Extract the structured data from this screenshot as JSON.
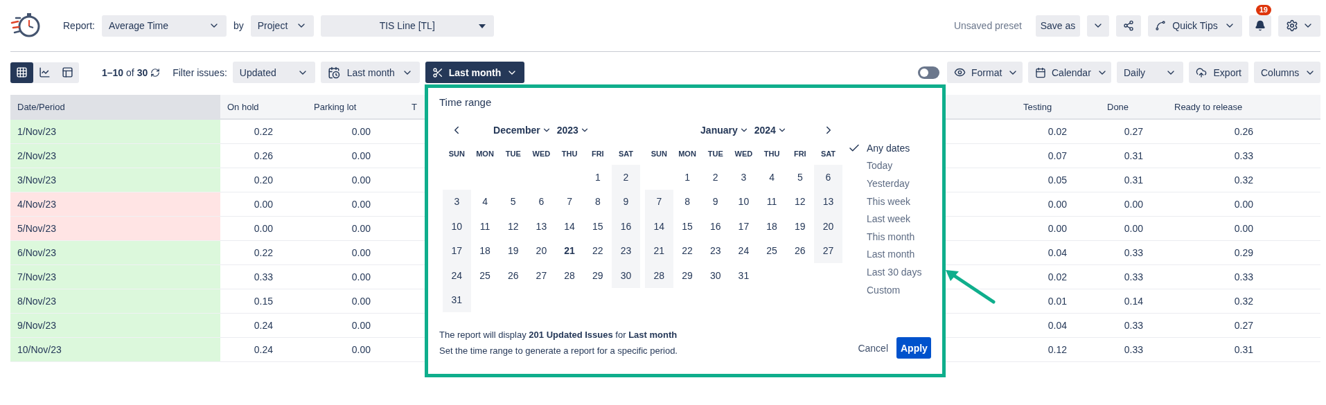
{
  "header": {
    "report_label": "Report:",
    "report_type": "Average Time",
    "by_label": "by",
    "group_by": "Project",
    "project": "TIS Line [TL]",
    "preset_status": "Unsaved preset",
    "save_button": "Save as",
    "quick_tips": "Quick Tips",
    "notifications_count": "19"
  },
  "toolbar": {
    "views": [
      {
        "kind": "grid",
        "selected": true
      },
      {
        "kind": "chart",
        "selected": false
      },
      {
        "kind": "panels",
        "selected": false
      }
    ],
    "paging": "**1–10** of **30**",
    "filter_label": "Filter issues:",
    "filter_field": "Updated",
    "date_filter": "Last month",
    "time_range_button": "Last month",
    "toggle_on": false,
    "format": "Format",
    "calendar": "Calendar",
    "interval": "Daily",
    "export": "Export",
    "columns": "Columns"
  },
  "table": {
    "columns": [
      "Date/Period",
      "On hold",
      "Parking lot",
      "T",
      "Testing",
      "Done",
      "Ready to release"
    ],
    "rows": [
      {
        "date": "1/Nov/23",
        "weekend": false,
        "on_hold": "0.22",
        "parking_lot": "0.00",
        "testing": "0.02",
        "done": "0.27",
        "ready_to_release": "0.26"
      },
      {
        "date": "2/Nov/23",
        "weekend": false,
        "on_hold": "0.26",
        "parking_lot": "0.00",
        "testing": "0.07",
        "done": "0.31",
        "ready_to_release": "0.33"
      },
      {
        "date": "3/Nov/23",
        "weekend": false,
        "on_hold": "0.20",
        "parking_lot": "0.00",
        "testing": "0.05",
        "done": "0.31",
        "ready_to_release": "0.32"
      },
      {
        "date": "4/Nov/23",
        "weekend": true,
        "on_hold": "0.00",
        "parking_lot": "0.00",
        "testing": "0.00",
        "done": "0.00",
        "ready_to_release": "0.00"
      },
      {
        "date": "5/Nov/23",
        "weekend": true,
        "on_hold": "0.00",
        "parking_lot": "0.00",
        "testing": "0.00",
        "done": "0.00",
        "ready_to_release": "0.00"
      },
      {
        "date": "6/Nov/23",
        "weekend": false,
        "on_hold": "0.22",
        "parking_lot": "0.00",
        "testing": "0.04",
        "done": "0.33",
        "ready_to_release": "0.29"
      },
      {
        "date": "7/Nov/23",
        "weekend": false,
        "on_hold": "0.33",
        "parking_lot": "0.00",
        "testing": "0.02",
        "done": "0.33",
        "ready_to_release": "0.33"
      },
      {
        "date": "8/Nov/23",
        "weekend": false,
        "on_hold": "0.15",
        "parking_lot": "0.00",
        "testing": "0.01",
        "done": "0.14",
        "ready_to_release": "0.32"
      },
      {
        "date": "9/Nov/23",
        "weekend": false,
        "on_hold": "0.24",
        "parking_lot": "0.00",
        "testing": "0.04",
        "done": "0.33",
        "ready_to_release": "0.27"
      },
      {
        "date": "10/Nov/23",
        "weekend": false,
        "on_hold": "0.24",
        "parking_lot": "0.00",
        "testing": "0.12",
        "done": "0.33",
        "ready_to_release": "0.31"
      }
    ]
  },
  "time_range_popup": {
    "title": "Time range",
    "calendars": [
      {
        "month": "December",
        "year": "2023",
        "weekdays": [
          "SUN",
          "MON",
          "TUE",
          "WED",
          "THU",
          "FRI",
          "SAT"
        ],
        "weeks": [
          {
            "align_end": true,
            "days": [
              {
                "day": "1",
                "today": false
              },
              {
                "day": "2",
                "today": false
              }
            ]
          },
          {
            "days": [
              {
                "day": "3",
                "today": false
              },
              {
                "day": "4",
                "today": false
              },
              {
                "day": "5",
                "today": false
              },
              {
                "day": "6",
                "today": false
              },
              {
                "day": "7",
                "today": false
              },
              {
                "day": "8",
                "today": false
              },
              {
                "day": "9",
                "today": false
              }
            ]
          },
          {
            "days": [
              {
                "day": "10",
                "today": false
              },
              {
                "day": "11",
                "today": false
              },
              {
                "day": "12",
                "today": false
              },
              {
                "day": "13",
                "today": false
              },
              {
                "day": "14",
                "today": false
              },
              {
                "day": "15",
                "today": false
              },
              {
                "day": "16",
                "today": false
              }
            ]
          },
          {
            "days": [
              {
                "day": "17",
                "today": false
              },
              {
                "day": "18",
                "today": false
              },
              {
                "day": "19",
                "today": false
              },
              {
                "day": "20",
                "today": false
              },
              {
                "day": "21",
                "today": true
              },
              {
                "day": "22",
                "today": false
              },
              {
                "day": "23",
                "today": false
              }
            ]
          },
          {
            "days": [
              {
                "day": "24",
                "today": false
              },
              {
                "day": "25",
                "today": false
              },
              {
                "day": "26",
                "today": false
              },
              {
                "day": "27",
                "today": false
              },
              {
                "day": "28",
                "today": false
              },
              {
                "day": "29",
                "today": false
              },
              {
                "day": "30",
                "today": false
              }
            ]
          },
          {
            "align_end": false,
            "days": [
              {
                "day": "31",
                "today": false
              }
            ]
          }
        ]
      },
      {
        "month": "January",
        "year": "2024",
        "weekdays": [
          "SUN",
          "MON",
          "TUE",
          "WED",
          "THU",
          "FRI",
          "SAT"
        ],
        "weeks": [
          {
            "align_end": true,
            "days": [
              {
                "day": "1",
                "today": false
              },
              {
                "day": "2",
                "today": false
              },
              {
                "day": "3",
                "today": false
              },
              {
                "day": "4",
                "today": false
              },
              {
                "day": "5",
                "today": false
              },
              {
                "day": "6",
                "today": false
              }
            ]
          },
          {
            "days": [
              {
                "day": "7",
                "today": false
              },
              {
                "day": "8",
                "today": false
              },
              {
                "day": "9",
                "today": false
              },
              {
                "day": "10",
                "today": false
              },
              {
                "day": "11",
                "today": false
              },
              {
                "day": "12",
                "today": false
              },
              {
                "day": "13",
                "today": false
              }
            ]
          },
          {
            "days": [
              {
                "day": "14",
                "today": false
              },
              {
                "day": "15",
                "today": false
              },
              {
                "day": "16",
                "today": false
              },
              {
                "day": "17",
                "today": false
              },
              {
                "day": "18",
                "today": false
              },
              {
                "day": "19",
                "today": false
              },
              {
                "day": "20",
                "today": false
              }
            ]
          },
          {
            "days": [
              {
                "day": "21",
                "today": false
              },
              {
                "day": "22",
                "today": false
              },
              {
                "day": "23",
                "today": false
              },
              {
                "day": "24",
                "today": false
              },
              {
                "day": "25",
                "today": false
              },
              {
                "day": "26",
                "today": false
              },
              {
                "day": "27",
                "today": false
              }
            ]
          },
          {
            "align_end": false,
            "days": [
              {
                "day": "28",
                "today": false
              },
              {
                "day": "29",
                "today": false
              },
              {
                "day": "30",
                "today": false
              },
              {
                "day": "31",
                "today": false
              }
            ]
          }
        ]
      }
    ],
    "presets": [
      {
        "label": "Any dates",
        "selected": true
      },
      {
        "label": "Today",
        "selected": false
      },
      {
        "label": "Yesterday",
        "selected": false
      },
      {
        "label": "This week",
        "selected": false
      },
      {
        "label": "Last week",
        "selected": false
      },
      {
        "label": "This month",
        "selected": false
      },
      {
        "label": "Last month",
        "selected": false
      },
      {
        "label": "Last 30 days",
        "selected": false
      },
      {
        "label": "Custom",
        "selected": false
      }
    ],
    "summary": "The report will display **201 Updated Issues** for **Last month**",
    "hint": "Set the time range to generate a report for a specific period.",
    "cancel": "Cancel",
    "apply": "Apply"
  }
}
